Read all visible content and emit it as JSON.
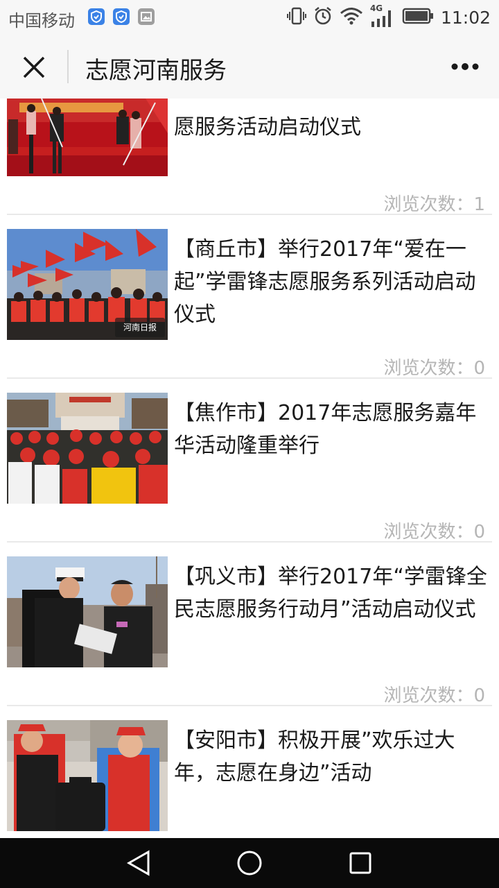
{
  "status_bar": {
    "carrier": "中国移动",
    "network": "4G",
    "time": "11:02"
  },
  "header": {
    "title": "志愿河南服务",
    "close_icon": "close-icon",
    "more_icon": "more-dots-icon"
  },
  "articles": [
    {
      "title": "愿服务活动启动仪式",
      "views": "浏览次数：1"
    },
    {
      "title": "【商丘市】举行2017年“爱在一起”学雷锋志愿服务系列活动启动仪式",
      "views": "浏览次数：0",
      "watermark": "河南日报"
    },
    {
      "title": "【焦作市】2017年志愿服务嘉年华活动隆重举行",
      "views": "浏览次数：0"
    },
    {
      "title": "【巩义市】举行2017年“学雷锋全民志愿服务行动月”活动启动仪式",
      "views": "浏览次数：0"
    },
    {
      "title": "【安阳市】积极开展”欢乐过大年，志愿在身边”活动"
    }
  ],
  "nav_bar": {
    "back_icon": "back-triangle-icon",
    "home_icon": "home-circle-icon",
    "recents_icon": "recents-square-icon"
  },
  "colors": {
    "accent_red": "#d8312a",
    "background": "#ffffff",
    "view_count_gray": "#b5b5b5"
  }
}
